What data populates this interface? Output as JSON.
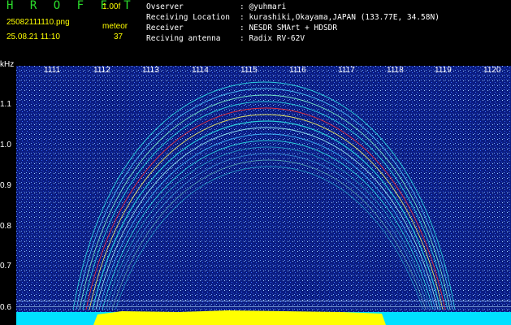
{
  "header": {
    "program": "H R O F F T",
    "version": "1.00f",
    "filename": "25082111110.png",
    "timestamp": "25.08.21 11:10",
    "mode_label": "meteor",
    "count": "37"
  },
  "info": {
    "rows": [
      {
        "label": "Ovserver",
        "value": ": @yuhmari"
      },
      {
        "label": "Receiving Location",
        "value": ": kurashiki,Okayama,JAPAN (133.77E, 34.58N)"
      },
      {
        "label": "Receiver",
        "value": ": NESDR SMArt + HDSDR"
      },
      {
        "label": "Reciving antenna",
        "value": ": Radix RV-62V"
      }
    ]
  },
  "axes": {
    "y_unit": "kHz",
    "x_ticks": [
      "1111",
      "1112",
      "1113",
      "1114",
      "1115",
      "1116",
      "1117",
      "1118",
      "1119",
      "1120"
    ],
    "y_ticks": [
      "1.1",
      "1.0",
      "0.9",
      "0.8",
      "0.7",
      "0.6"
    ]
  },
  "colors": {
    "background": "#000000",
    "spectrogram_base": "#0a1a78",
    "signal_cyan": "#2ee8e8",
    "signal_yellow": "#ffff00",
    "signal_red": "#ff3030",
    "title_green": "#2bdc2b"
  }
}
